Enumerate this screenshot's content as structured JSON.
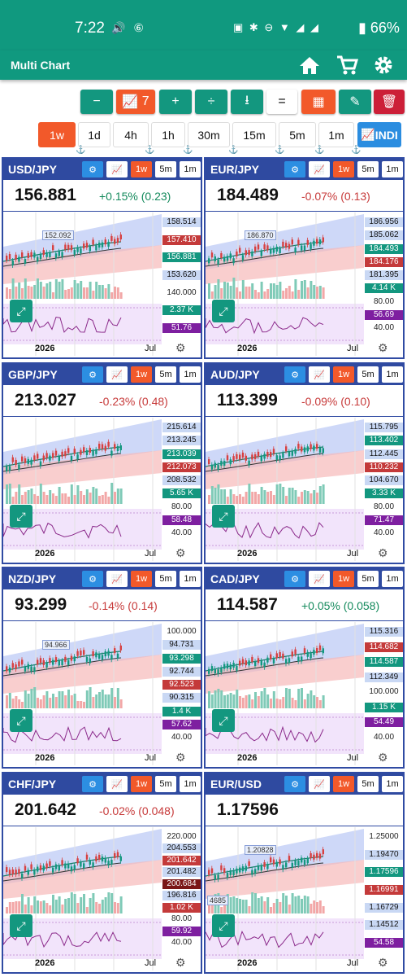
{
  "status": {
    "time": "7:22",
    "battery": "66%"
  },
  "app": {
    "title": "Multi Chart"
  },
  "toolbar": {
    "minus": "−",
    "chart_count": "7",
    "plus": "+",
    "sep1": "÷",
    "sep2": "⭳",
    "eq": "="
  },
  "timeframes": [
    "1w",
    "1d",
    "4h",
    "1h",
    "30m",
    "15m",
    "5m",
    "1m"
  ],
  "indi_label": "INDI",
  "panel_buttons": [
    "1w",
    "5m",
    "1m"
  ],
  "panels": [
    {
      "symbol": "USD/JPY",
      "price": "156.881",
      "change": "+0.15% (0.23)",
      "dir": "up",
      "labels": [
        {
          "t": "158.514",
          "c": "blue"
        },
        {
          "t": "157.410",
          "c": "red"
        },
        {
          "t": "156.881",
          "c": "grn"
        },
        {
          "t": "153.620",
          "c": "blue"
        },
        {
          "t": "140.000",
          "c": "plain"
        },
        {
          "t": "2.37 K",
          "c": "grn"
        },
        {
          "t": "51.76",
          "c": "pur"
        }
      ],
      "annotations": [
        "152.092"
      ],
      "year": "2026",
      "month": "Jul"
    },
    {
      "symbol": "EUR/JPY",
      "price": "184.489",
      "change": "-0.07% (0.13)",
      "dir": "down",
      "labels": [
        {
          "t": "186.956",
          "c": "blue"
        },
        {
          "t": "185.062",
          "c": "blue"
        },
        {
          "t": "184.493",
          "c": "grn"
        },
        {
          "t": "184.176",
          "c": "red"
        },
        {
          "t": "181.395",
          "c": "blue"
        },
        {
          "t": "4.14 K",
          "c": "grn"
        },
        {
          "t": "80.00",
          "c": "plain"
        },
        {
          "t": "56.69",
          "c": "pur"
        },
        {
          "t": "40.00",
          "c": "plain"
        }
      ],
      "annotations": [
        "186.870"
      ],
      "year": "2026",
      "month": "Jul"
    },
    {
      "symbol": "GBP/JPY",
      "price": "213.027",
      "change": "-0.23% (0.48)",
      "dir": "down",
      "labels": [
        {
          "t": "215.614",
          "c": "blue"
        },
        {
          "t": "213.245",
          "c": "blue"
        },
        {
          "t": "213.039",
          "c": "grn"
        },
        {
          "t": "212.073",
          "c": "red"
        },
        {
          "t": "208.532",
          "c": "blue"
        },
        {
          "t": "5.65 K",
          "c": "grn"
        },
        {
          "t": "80.00",
          "c": "plain"
        },
        {
          "t": "58.48",
          "c": "pur"
        },
        {
          "t": "40.00",
          "c": "plain"
        }
      ],
      "annotations": [],
      "year": "2026",
      "month": "Jul"
    },
    {
      "symbol": "AUD/JPY",
      "price": "113.399",
      "change": "-0.09% (0.10)",
      "dir": "down",
      "labels": [
        {
          "t": "115.795",
          "c": "blue"
        },
        {
          "t": "113.402",
          "c": "grn"
        },
        {
          "t": "112.445",
          "c": "blue"
        },
        {
          "t": "110.232",
          "c": "red"
        },
        {
          "t": "104.670",
          "c": "blue"
        },
        {
          "t": "3.33 K",
          "c": "grn"
        },
        {
          "t": "80.00",
          "c": "plain"
        },
        {
          "t": "71.47",
          "c": "pur"
        },
        {
          "t": "40.00",
          "c": "plain"
        }
      ],
      "annotations": [],
      "year": "2026",
      "month": "Jul"
    },
    {
      "symbol": "NZD/JPY",
      "price": "93.299",
      "change": "-0.14% (0.14)",
      "dir": "down",
      "labels": [
        {
          "t": "100.000",
          "c": "plain"
        },
        {
          "t": "94.731",
          "c": "blue"
        },
        {
          "t": "93.298",
          "c": "grn"
        },
        {
          "t": "92.744",
          "c": "blue"
        },
        {
          "t": "92.523",
          "c": "red"
        },
        {
          "t": "90.315",
          "c": "blue"
        },
        {
          "t": "1.4 K",
          "c": "grn"
        },
        {
          "t": "57.62",
          "c": "pur"
        },
        {
          "t": "40.00",
          "c": "plain"
        }
      ],
      "annotations": [
        "94.966"
      ],
      "year": "2026",
      "month": "Jul"
    },
    {
      "symbol": "CAD/JPY",
      "price": "114.587",
      "change": "+0.05% (0.058)",
      "dir": "up",
      "labels": [
        {
          "t": "115.316",
          "c": "blue"
        },
        {
          "t": "114.682",
          "c": "red"
        },
        {
          "t": "114.587",
          "c": "grn"
        },
        {
          "t": "112.349",
          "c": "blue"
        },
        {
          "t": "100.000",
          "c": "plain"
        },
        {
          "t": "1.15 K",
          "c": "grn"
        },
        {
          "t": "54.49",
          "c": "pur"
        },
        {
          "t": "40.00",
          "c": "plain"
        }
      ],
      "annotations": [],
      "year": "2026",
      "month": "Jul"
    },
    {
      "symbol": "CHF/JPY",
      "price": "201.642",
      "change": "-0.02% (0.048)",
      "dir": "down",
      "labels": [
        {
          "t": "220.000",
          "c": "plain"
        },
        {
          "t": "204.553",
          "c": "blue"
        },
        {
          "t": "201.642",
          "c": "red"
        },
        {
          "t": "201.482",
          "c": "blue"
        },
        {
          "t": "200.684",
          "c": "dred"
        },
        {
          "t": "196.816",
          "c": "blue"
        },
        {
          "t": "1.02 K",
          "c": "red"
        },
        {
          "t": "80.00",
          "c": "plain"
        },
        {
          "t": "59.92",
          "c": "pur"
        },
        {
          "t": "40.00",
          "c": "plain"
        }
      ],
      "annotations": [],
      "year": "2026",
      "month": "Jul"
    },
    {
      "symbol": "EUR/USD",
      "price": "1.17596",
      "change": "",
      "dir": "up",
      "labels": [
        {
          "t": "1.25000",
          "c": "plain"
        },
        {
          "t": "1.19470",
          "c": "blue"
        },
        {
          "t": "1.17596",
          "c": "grn"
        },
        {
          "t": "1.16991",
          "c": "red"
        },
        {
          "t": "1.16729",
          "c": "blue"
        },
        {
          "t": "1.14512",
          "c": "blue"
        },
        {
          "t": "54.58",
          "c": "pur"
        }
      ],
      "annotations": [
        "1.20828",
        "4685"
      ],
      "year": "2026",
      "month": "Jul"
    }
  ],
  "colors": {
    "teal": "#13977f",
    "orange": "#f2592a",
    "header_blue": "#2f4aa0",
    "btn_blue": "#2c8ee2",
    "up": "#148a5c",
    "down": "#c73a3a"
  }
}
